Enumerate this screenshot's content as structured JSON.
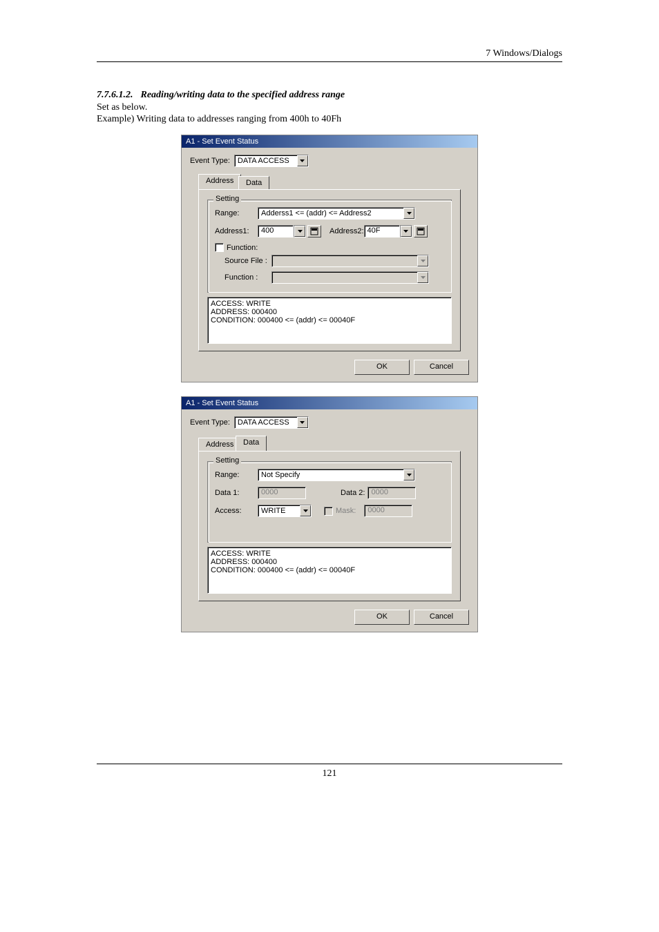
{
  "header": {
    "chapter": "7  Windows/Dialogs"
  },
  "section": {
    "number": "7.7.6.1.2.",
    "title": "Reading/writing data to the specified address range",
    "line1": "Set as below.",
    "line2": "Example) Writing data to addresses ranging from 400h to 40Fh"
  },
  "dialog1": {
    "title": "A1 - Set Event Status",
    "event_type_label": "Event Type:",
    "event_type_value": "DATA ACCESS",
    "tabs": {
      "address": "Address",
      "data": "Data"
    },
    "group_title": "Setting",
    "range_label": "Range:",
    "range_value": "Adderss1 <= (addr) <= Address2",
    "address1_label": "Address1:",
    "address1_value": "400",
    "address2_label": "Address2:",
    "address2_value": "40F",
    "function_check": "Function:",
    "source_file_label": "Source File :",
    "function_label": "Function :",
    "summary": "ACCESS: WRITE\nADDRESS: 000400\nCONDITION: 000400 <= (addr) <= 00040F",
    "ok": "OK",
    "cancel": "Cancel"
  },
  "dialog2": {
    "title": "A1 - Set Event Status",
    "event_type_label": "Event Type:",
    "event_type_value": "DATA ACCESS",
    "tabs": {
      "address": "Address",
      "data": "Data"
    },
    "group_title": "Setting",
    "range_label": "Range:",
    "range_value": "Not Specify",
    "data1_label": "Data 1:",
    "data1_value": "0000",
    "data2_label": "Data 2:",
    "data2_value": "0000",
    "access_label": "Access:",
    "access_value": "WRITE",
    "mask_label": "Mask:",
    "mask_value": "0000",
    "summary": "ACCESS: WRITE\nADDRESS: 000400\nCONDITION: 000400 <= (addr) <= 00040F",
    "ok": "OK",
    "cancel": "Cancel"
  },
  "page_number": "121"
}
